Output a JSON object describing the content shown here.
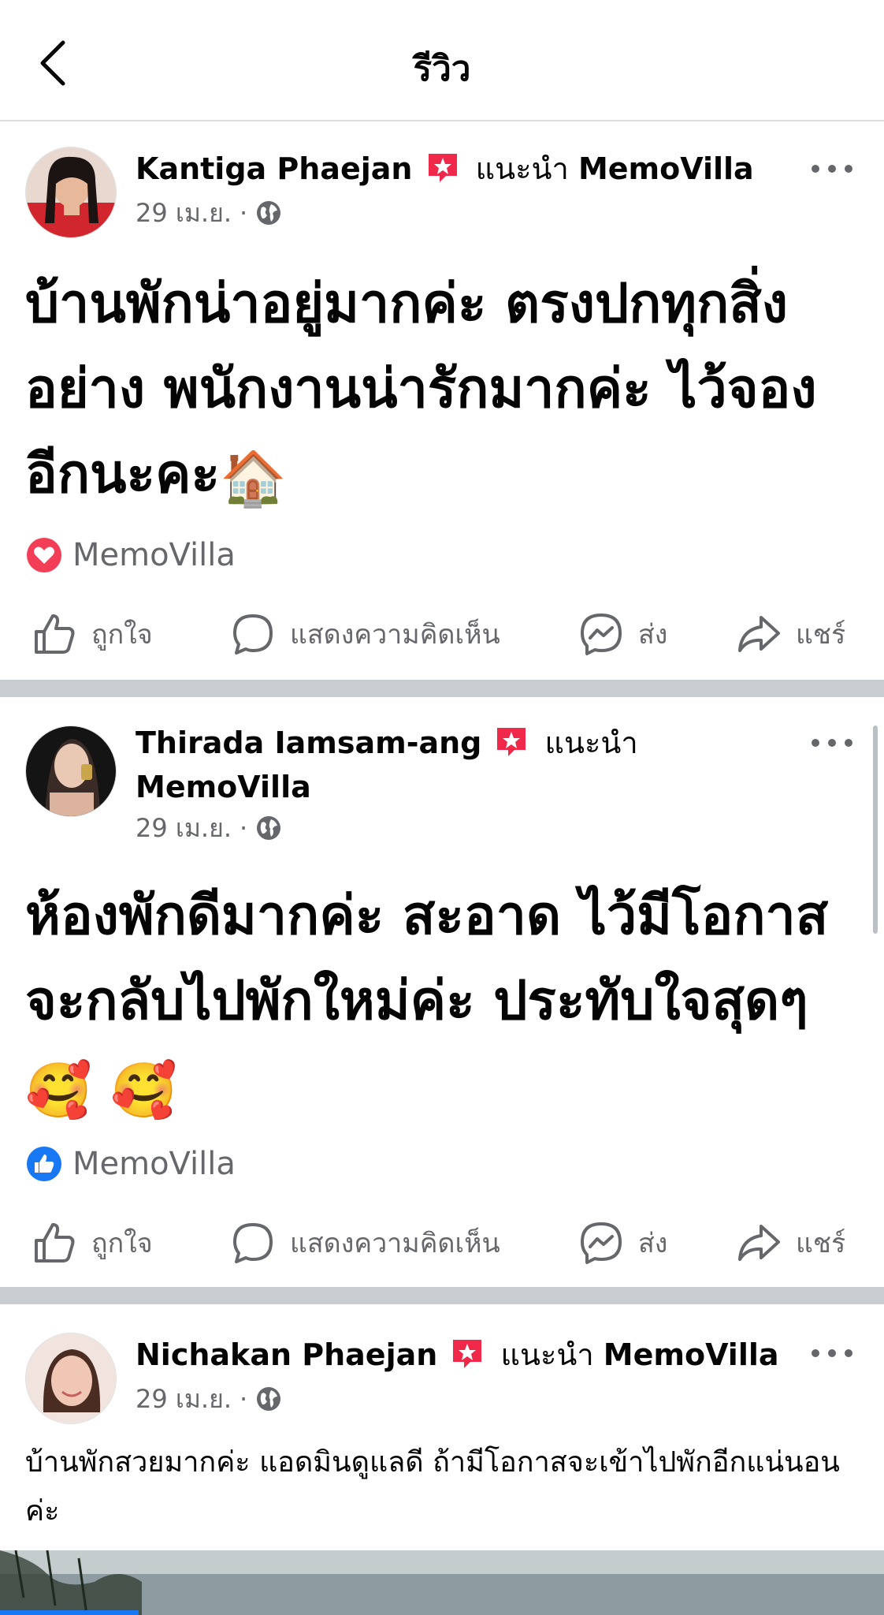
{
  "header": {
    "title": "รีวิว"
  },
  "reviews": [
    {
      "author": "Kantiga Phaejan",
      "recommend_text": "แนะนำ",
      "page": "MemoVilla",
      "date": "29 เม.ย.",
      "text": "บ้านพักน่าอยู่มากค่ะ ตรงปกทุกสิ่งอย่าง พนักงานน่ารักมากค่ะ ไว้จองอีกนะคะ",
      "emoji": "🏠",
      "reaction_icon": "heart-reaction-icon",
      "reaction_label": "MemoVilla"
    },
    {
      "author": "Thirada Iamsam-ang",
      "recommend_text": "แนะนำ",
      "page": "MemoVilla",
      "date": "29 เม.ย.",
      "text": "ห้องพักดีมากค่ะ สะอาด ไว้มีโอกาสจะกลับไปพักใหม่ค่ะ ประทับใจสุดๆ",
      "emoji": "🥰 🥰",
      "reaction_icon": "like-reaction-icon",
      "reaction_label": "MemoVilla"
    },
    {
      "author": "Nichakan Phaejan",
      "recommend_text": "แนะนำ",
      "page": "MemoVilla",
      "date": "29 เม.ย.",
      "text": "บ้านพักสวยมากค่ะ แอดมินดูแลดี ถ้ามีโอกาสจะเข้าไปพักอีกแน่นอนค่ะ"
    }
  ],
  "actions": {
    "like": "ถูกใจ",
    "comment": "แสดงความคิดเห็น",
    "send": "ส่ง",
    "share": "แชร์"
  },
  "colors": {
    "text": "#050505",
    "secondary": "#65676b",
    "divider": "#c9ccd1",
    "recommend_badge": "#f02849",
    "like_blue": "#1877f2"
  }
}
